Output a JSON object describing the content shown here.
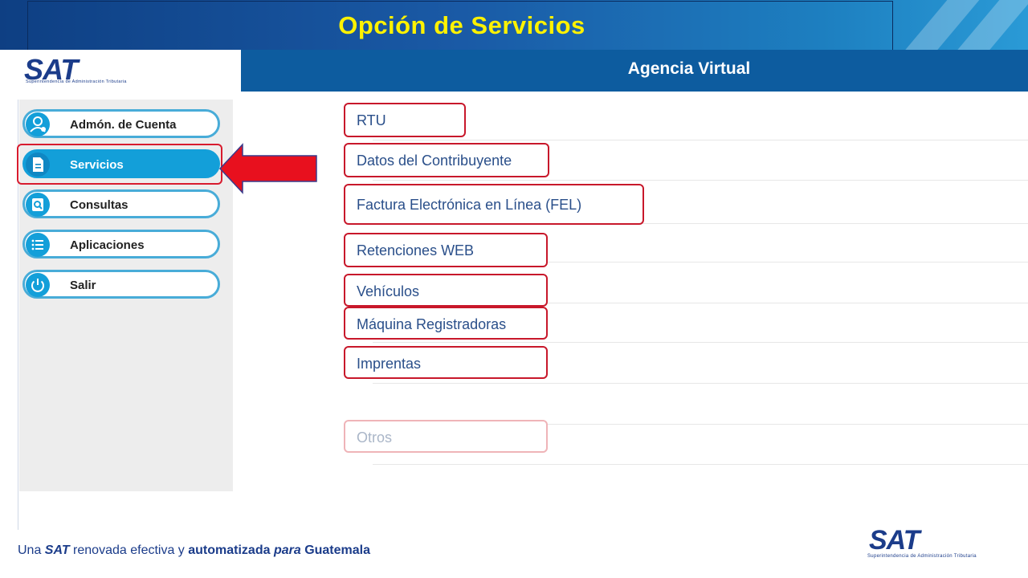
{
  "slide": {
    "title": "Opción de Servicios",
    "tagline_parts": [
      "Una ",
      "SAT",
      " renovada ",
      "efectiva",
      " y ",
      "automatizada",
      " para ",
      "Guatemala"
    ]
  },
  "header": {
    "logo_text": "SAT",
    "logo_subtitle": "Superintendencia de Administración Tributaria",
    "agency_title": "Agencia Virtual"
  },
  "sidebar": {
    "items": [
      {
        "label": "Admón. de Cuenta",
        "icon": "user-gear-icon",
        "active": false
      },
      {
        "label": "Servicios",
        "icon": "document-icon",
        "active": true
      },
      {
        "label": "Consultas",
        "icon": "search-icon",
        "active": false
      },
      {
        "label": "Aplicaciones",
        "icon": "list-icon",
        "active": false
      },
      {
        "label": "Salir",
        "icon": "power-icon",
        "active": false
      }
    ]
  },
  "services": {
    "options": [
      {
        "label": "RTU"
      },
      {
        "label": "Datos del Contribuyente"
      },
      {
        "label": "Factura Electrónica en Línea (FEL)"
      },
      {
        "label": "Retenciones WEB"
      },
      {
        "label": "Vehículos"
      },
      {
        "label": "Máquina Registradoras"
      },
      {
        "label": "Imprentas"
      },
      {
        "label": "Otros"
      }
    ]
  },
  "colors": {
    "title_yellow": "#fff200",
    "header_blue": "#0d5c9f",
    "menu_accent": "#139fd9",
    "highlight_red": "#d81b2e"
  }
}
